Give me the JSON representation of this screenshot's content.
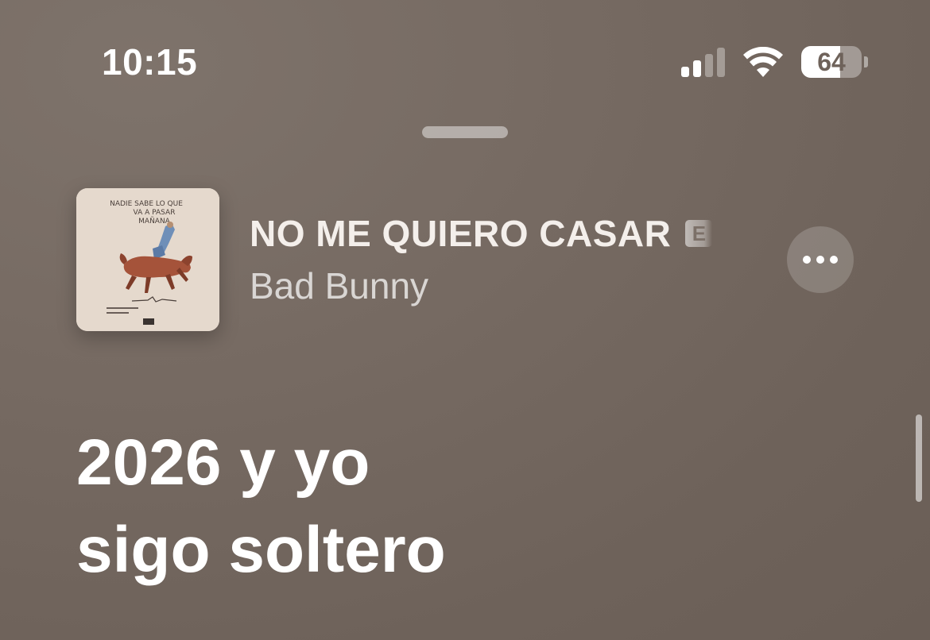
{
  "status_bar": {
    "time": "10:15",
    "battery_level": "64",
    "battery_fraction": 0.64,
    "signal_bars_active": 2,
    "signal_bars_total": 4,
    "icons": [
      "cellular-signal-icon",
      "wifi-icon",
      "battery-icon"
    ]
  },
  "now_playing": {
    "title": "NO ME QUIERO CASAR",
    "explicit_badge": "E",
    "artist": "Bad Bunny",
    "more_icon": "ellipsis-icon"
  },
  "album_art": {
    "cover_text": "NADIE SABE LO QUE VA A PASAR MAÑANA"
  },
  "lyrics": {
    "lines": [
      "2026 y yo",
      "sigo soltero"
    ]
  },
  "colors": {
    "background": "#756960",
    "text_primary": "#ffffff",
    "text_secondary": "#d8d0ca"
  }
}
